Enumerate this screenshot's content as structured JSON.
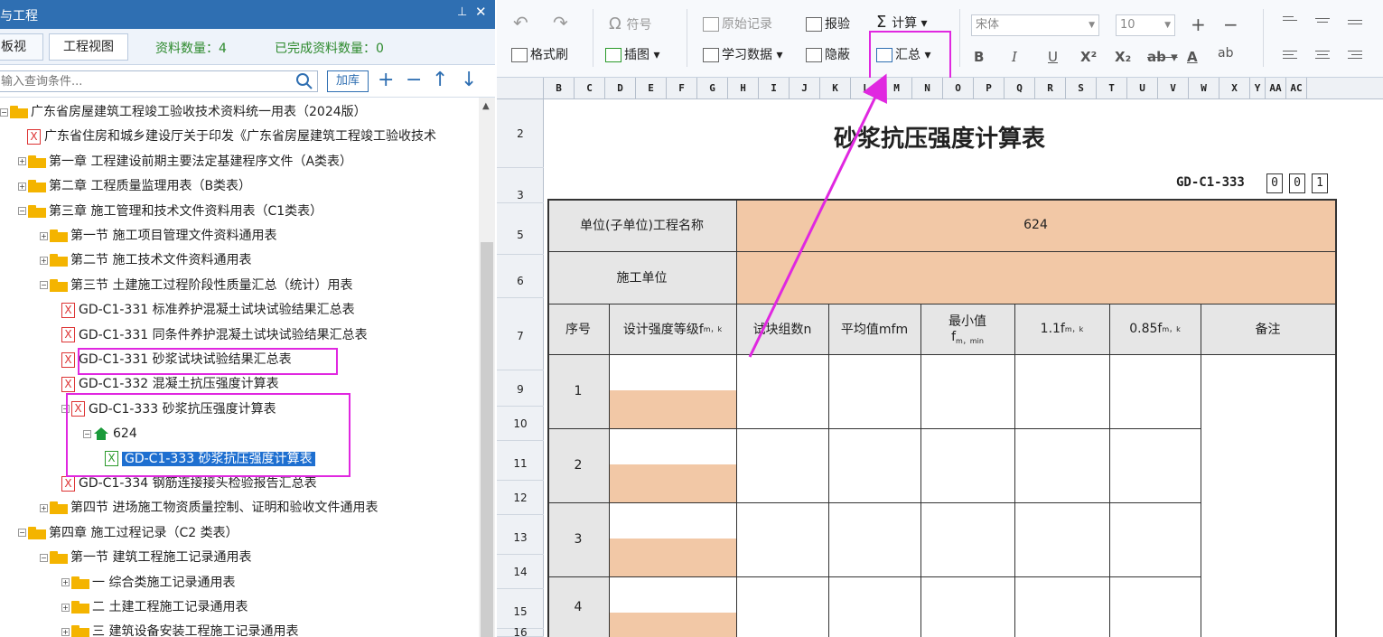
{
  "left_panel": {
    "title": "与工程",
    "pin": "ⅼ",
    "close": "✕",
    "tabs": [
      "板视图",
      "工程视图"
    ],
    "stat_count": "资料数量：4",
    "stat_done": "已完成资料数量：0",
    "search_placeholder": "输入查询条件...",
    "jiaku": "加库",
    "tree": [
      {
        "label": "广东省房屋建筑工程竣工验收技术资料统一用表（2024版）",
        "type": "folder",
        "exp": "−"
      },
      {
        "label": "广东省住房和城乡建设厅关于印发《广东省房屋建筑工程竣工验收技术",
        "type": "file"
      },
      {
        "label": "第一章  工程建设前期主要法定基建程序文件（A类表）",
        "type": "folder",
        "exp": "+"
      },
      {
        "label": "第二章  工程质量监理用表（B类表）",
        "type": "folder",
        "exp": "+"
      },
      {
        "label": "第三章  施工管理和技术文件资料用表（C1类表）",
        "type": "folder",
        "exp": "−"
      },
      {
        "label": "第一节  施工项目管理文件资料通用表",
        "type": "folder",
        "exp": "+"
      },
      {
        "label": "第二节  施工技术文件资料通用表",
        "type": "folder",
        "exp": "+"
      },
      {
        "label": "第三节  土建施工过程阶段性质量汇总（统计）用表",
        "type": "folder",
        "exp": "−"
      },
      {
        "label": "GD-C1-331  标准养护混凝土试块试验结果汇总表",
        "type": "file"
      },
      {
        "label": "GD-C1-331  同条件养护混凝土试块试验结果汇总表",
        "type": "file"
      },
      {
        "label": "GD-C1-331  砂浆试块试验结果汇总表",
        "type": "file"
      },
      {
        "label": "GD-C1-332  混凝土抗压强度计算表",
        "type": "file"
      },
      {
        "label": "GD-C1-333  砂浆抗压强度计算表",
        "type": "file",
        "exp": "−"
      },
      {
        "label": "624",
        "type": "house",
        "exp": "−"
      },
      {
        "label": "GD-C1-333  砂浆抗压强度计算表",
        "type": "file-green",
        "selected": true
      },
      {
        "label": "GD-C1-334  钢筋连接接头检验报告汇总表",
        "type": "file"
      },
      {
        "label": "第四节  进场施工物资质量控制、证明和验收文件通用表",
        "type": "folder",
        "exp": "+"
      },
      {
        "label": "第四章  施工过程记录（C2 类表）",
        "type": "folder",
        "exp": "−"
      },
      {
        "label": "第一节  建筑工程施工记录通用表",
        "type": "folder",
        "exp": "−"
      },
      {
        "label": "一  综合类施工记录通用表",
        "type": "folder",
        "exp": "+"
      },
      {
        "label": "二  土建工程施工记录通用表",
        "type": "folder",
        "exp": "+"
      },
      {
        "label": "三  建筑设备安装工程施工记录通用表",
        "type": "folder",
        "exp": "+"
      }
    ]
  },
  "ribbon": {
    "undo": "↶",
    "redo": "↷",
    "symbol": "符号",
    "original": "原始记录",
    "report": "报验",
    "calc": "计算",
    "format_brush": "格式刷",
    "insert_pic": "插图",
    "study_data": "学习数据",
    "hide": "隐蔽",
    "summary": "汇总",
    "font": "宋体",
    "size": "10",
    "bold": "B",
    "italic": "I",
    "underline": "U",
    "sup": "X²",
    "sub": "X₂",
    "strike": "ab",
    "fontcolor": "A",
    "pinyin": "ab",
    "plus": "+",
    "minus": "−"
  },
  "sheet": {
    "columns": [
      "B",
      "C",
      "D",
      "E",
      "F",
      "G",
      "H",
      "I",
      "J",
      "K",
      "L",
      "M",
      "N",
      "O",
      "P",
      "Q",
      "R",
      "S",
      "T",
      "U",
      "V",
      "W",
      "X",
      "Y",
      "AA",
      "AC"
    ],
    "rows": [
      "2",
      "3",
      "5",
      "6",
      "7",
      "9",
      "10",
      "11",
      "12",
      "13",
      "14",
      "15",
      "16"
    ],
    "title": "砂浆抗压强度计算表",
    "code": "GD-C1-333",
    "code_boxes": [
      "0",
      "0",
      "1"
    ],
    "project_label": "单位(子单位)工程名称",
    "project_value": "624",
    "construction_label": "施工单位",
    "headers": {
      "no": "序号",
      "grade": "设计强度等级f",
      "grade_sub": "m，k",
      "groups": "试块组数n",
      "avg": "平均值mfm",
      "min": "最小值",
      "min_f": "f",
      "min_sub": "m，min",
      "p11": "1.1f",
      "p11_sub": "m，k",
      "p085": "0.85f",
      "p085_sub": "m，k",
      "remark": "备注"
    },
    "row_numbers": [
      "1",
      "2",
      "3",
      "4"
    ]
  }
}
